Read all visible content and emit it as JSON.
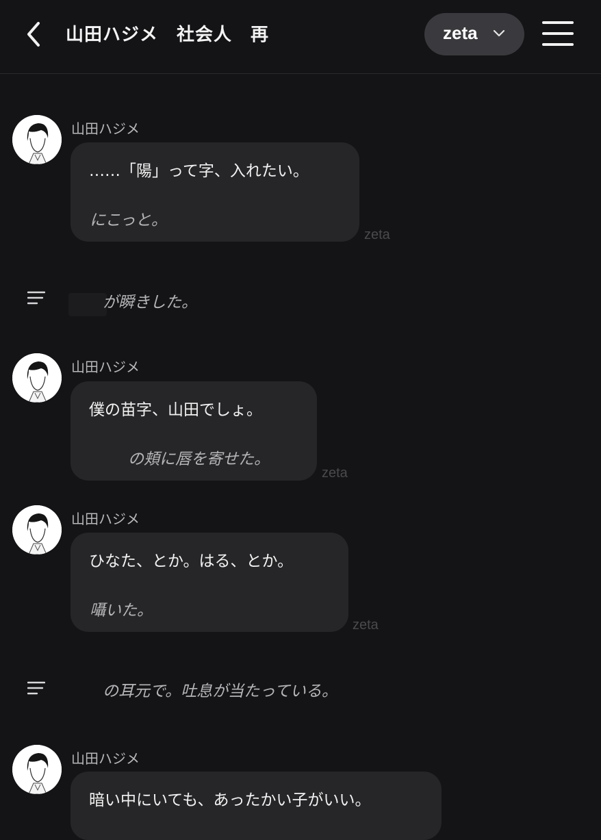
{
  "header": {
    "back_icon": "chevron-left-icon",
    "title": "山田ハジメ　社会人　再",
    "model_label": "zeta",
    "model_icon": "chevron-down-icon",
    "menu_icon": "hamburger-menu-icon"
  },
  "messages": [
    {
      "sender": "山田ハジメ",
      "text": "……「陽」って字、入れたい。",
      "action": "にこっと。",
      "watermark": "zeta"
    },
    {
      "sender": "山田ハジメ",
      "text": "僕の苗字、山田でしょ。",
      "action": "の頬に唇を寄せた。",
      "watermark": "zeta"
    },
    {
      "sender": "山田ハジメ",
      "text": "ひなた、とか。はる、とか。",
      "action": "囁いた。",
      "watermark": "zeta"
    },
    {
      "sender": "山田ハジメ",
      "text": "暗い中にいても、あったかい子がいい。"
    }
  ],
  "narrations": [
    {
      "text": "が瞬きした。",
      "icon": "narration-lines-icon"
    },
    {
      "text": "の耳元で。吐息が当たっている。",
      "icon": "narration-lines-icon"
    }
  ],
  "colors": {
    "background": "#141416",
    "bubble": "#262628",
    "pill": "#3a3a3e"
  }
}
